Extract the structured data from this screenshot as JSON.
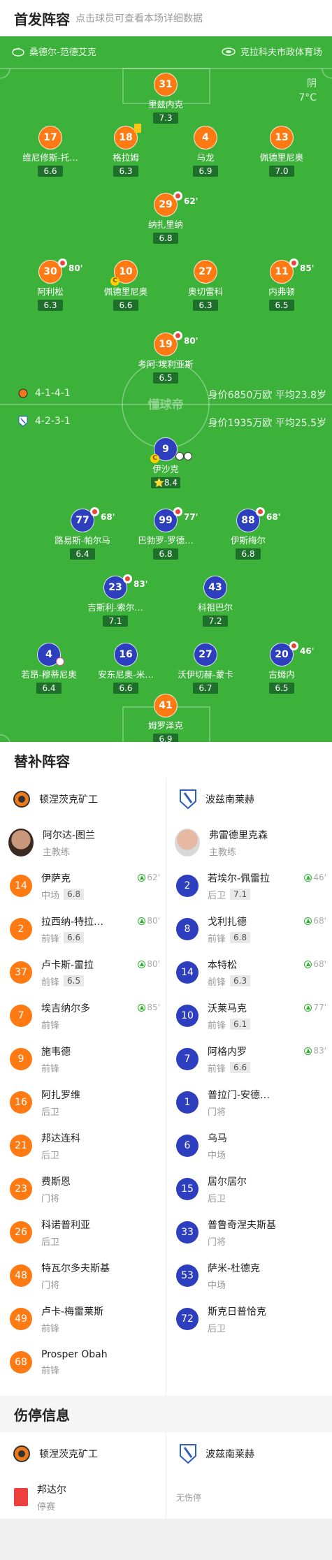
{
  "header": {
    "title": "首发阵容",
    "subtitle": "点击球员可查看本场详细数据"
  },
  "teams": {
    "home": "桑德尔-范德艾克",
    "away": "克拉科夫市政体育场"
  },
  "weather": {
    "condition": "阴",
    "temp": "7°C"
  },
  "watermark": "懂球帝",
  "home_players": [
    {
      "num": "31",
      "name": "里兹内克",
      "rating": "7.3"
    },
    {
      "num": "17",
      "name": "维尼修斯-托…",
      "rating": "6.6"
    },
    {
      "num": "18",
      "name": "格拉姆",
      "rating": "6.3"
    },
    {
      "num": "4",
      "name": "马龙",
      "rating": "6.9"
    },
    {
      "num": "13",
      "name": "佩德里尼奥",
      "rating": "7.0"
    },
    {
      "num": "29",
      "name": "纳扎里纳",
      "rating": "6.8",
      "sub": "62'"
    },
    {
      "num": "30",
      "name": "阿利松",
      "rating": "6.3",
      "sub": "80'"
    },
    {
      "num": "10",
      "name": "佩德里尼奥",
      "rating": "6.6"
    },
    {
      "num": "27",
      "name": "奥切雷科",
      "rating": "6.3"
    },
    {
      "num": "11",
      "name": "内弗顿",
      "rating": "6.5",
      "sub": "85'"
    },
    {
      "num": "19",
      "name": "考阿-埃利亚斯",
      "rating": "6.5",
      "sub": "80'"
    }
  ],
  "away_players": [
    {
      "num": "9",
      "name": "伊沙克",
      "rating": "8.4"
    },
    {
      "num": "77",
      "name": "路易斯-帕尔马",
      "rating": "6.4",
      "sub": "68'"
    },
    {
      "num": "99",
      "name": "巴勃罗-罗德…",
      "rating": "6.8",
      "sub": "77'"
    },
    {
      "num": "88",
      "name": "伊斯梅尔",
      "rating": "6.8",
      "sub": "68'"
    },
    {
      "num": "23",
      "name": "吉斯利-索尔…",
      "rating": "7.1",
      "sub": "83'"
    },
    {
      "num": "43",
      "name": "科祖巴尔",
      "rating": "7.2"
    },
    {
      "num": "4",
      "name": "若昂-穆蒂尼奥",
      "rating": "6.4"
    },
    {
      "num": "16",
      "name": "安东尼奥-米…",
      "rating": "6.6"
    },
    {
      "num": "27",
      "name": "沃伊切赫-蒙卡",
      "rating": "6.7"
    },
    {
      "num": "20",
      "name": "古姆内",
      "rating": "6.5",
      "sub": "46'"
    },
    {
      "num": "41",
      "name": "姆罗泽克",
      "rating": "6.9"
    }
  ],
  "formations": {
    "home": {
      "formation": "4-1-4-1",
      "value": "身价6850万欧 平均23.8岁"
    },
    "away": {
      "formation": "4-2-3-1",
      "value": "身价1935万欧 平均25.5岁"
    }
  },
  "subs_section": {
    "title": "替补阵容",
    "home_team": "顿涅茨克矿工",
    "away_team": "波兹南莱赫",
    "home_coach": {
      "name": "阿尔达-图兰",
      "role": "主教练"
    },
    "away_coach": {
      "name": "弗雷德里克森",
      "role": "主教练"
    },
    "home": [
      {
        "num": "14",
        "name": "伊萨克",
        "pos": "中场",
        "rating": "6.8",
        "min": "62'"
      },
      {
        "num": "2",
        "name": "拉西纳-特拉…",
        "pos": "前锋",
        "rating": "6.6",
        "min": "80'"
      },
      {
        "num": "37",
        "name": "卢卡斯-雷拉",
        "pos": "前锋",
        "rating": "6.5",
        "min": "80'"
      },
      {
        "num": "7",
        "name": "埃吉纳尔多",
        "pos": "前锋",
        "rating": "",
        "min": "85'"
      },
      {
        "num": "9",
        "name": "施韦德",
        "pos": "前锋",
        "rating": "",
        "min": ""
      },
      {
        "num": "16",
        "name": "阿扎罗维",
        "pos": "后卫",
        "rating": "",
        "min": ""
      },
      {
        "num": "21",
        "name": "邦达连科",
        "pos": "后卫",
        "rating": "",
        "min": ""
      },
      {
        "num": "23",
        "name": "费斯恩",
        "pos": "门将",
        "rating": "",
        "min": ""
      },
      {
        "num": "26",
        "name": "科诺普利亚",
        "pos": "后卫",
        "rating": "",
        "min": ""
      },
      {
        "num": "48",
        "name": "特瓦尔多夫斯基",
        "pos": "门将",
        "rating": "",
        "min": ""
      },
      {
        "num": "49",
        "name": "卢卡-梅雷莱斯",
        "pos": "前锋",
        "rating": "",
        "min": ""
      },
      {
        "num": "68",
        "name": "Prosper Obah",
        "pos": "前锋",
        "rating": "",
        "min": ""
      }
    ],
    "away": [
      {
        "num": "2",
        "name": "若埃尔-佩雷拉",
        "pos": "后卫",
        "rating": "7.1",
        "min": "46'"
      },
      {
        "num": "8",
        "name": "戈利扎德",
        "pos": "前锋",
        "rating": "6.8",
        "min": "68'"
      },
      {
        "num": "14",
        "name": "本特松",
        "pos": "前锋",
        "rating": "6.3",
        "min": "68'"
      },
      {
        "num": "10",
        "name": "沃莱马克",
        "pos": "前锋",
        "rating": "6.1",
        "min": "77'"
      },
      {
        "num": "7",
        "name": "阿格内罗",
        "pos": "前锋",
        "rating": "6.6",
        "min": "83'"
      },
      {
        "num": "1",
        "name": "普拉门-安德…",
        "pos": "门将",
        "rating": "",
        "min": ""
      },
      {
        "num": "6",
        "name": "乌马",
        "pos": "中场",
        "rating": "",
        "min": ""
      },
      {
        "num": "15",
        "name": "居尔居尔",
        "pos": "后卫",
        "rating": "",
        "min": ""
      },
      {
        "num": "33",
        "name": "普鲁奇涅夫斯基",
        "pos": "门将",
        "rating": "",
        "min": ""
      },
      {
        "num": "53",
        "name": "萨米-杜德克",
        "pos": "中场",
        "rating": "",
        "min": ""
      },
      {
        "num": "72",
        "name": "斯克日普恰克",
        "pos": "后卫",
        "rating": "",
        "min": ""
      }
    ]
  },
  "injury_section": {
    "title": "伤停信息",
    "home_team": "顿涅茨克矿工",
    "away_team": "波兹南莱赫",
    "home_item": {
      "name": "邦达尔",
      "status": "停赛"
    },
    "away_none": "无伤停"
  }
}
